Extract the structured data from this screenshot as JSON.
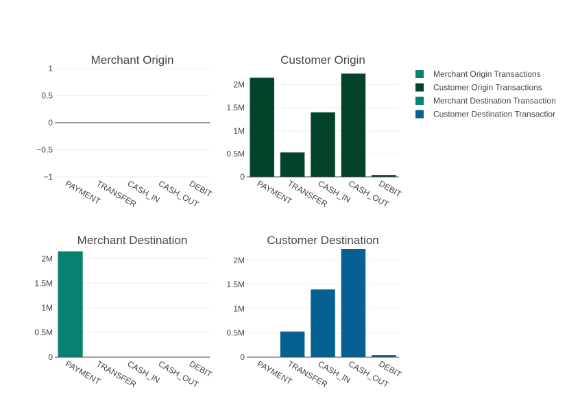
{
  "colors": {
    "merchant_origin": "#06826e",
    "customer_origin": "#03432a",
    "merchant_destination": "#06826e",
    "customer_destination": "#046191",
    "grid": "#eeeeee",
    "zeroline": "#444444",
    "text": "#444444"
  },
  "legend": {
    "items": [
      {
        "label": "Merchant Origin Transactions",
        "color": "#06826e"
      },
      {
        "label": "Customer Origin Transactions",
        "color": "#03432a"
      },
      {
        "label": "Merchant Destination Transaction",
        "color": "#06826e"
      },
      {
        "label": "Customer Destination Transactior",
        "color": "#046191"
      }
    ],
    "placement": "top-right"
  },
  "chart_data": [
    {
      "type": "bar",
      "title": "Merchant Origin",
      "categories": [
        "PAYMENT",
        "TRANSFER",
        "CASH_IN",
        "CASH_OUT",
        "DEBIT"
      ],
      "series": [
        {
          "name": "Merchant Origin Transactions",
          "values": [
            0,
            0,
            0,
            0,
            0
          ]
        }
      ],
      "ylim": [
        -1,
        1
      ],
      "yticks": [
        -1,
        -0.5,
        0,
        0.5,
        1
      ],
      "ytick_labels": [
        "−1",
        "−0.5",
        "0",
        "0.5",
        "1"
      ],
      "grid": true,
      "color": "#06826e"
    },
    {
      "type": "bar",
      "title": "Customer Origin",
      "categories": [
        "PAYMENT",
        "TRANSFER",
        "CASH_IN",
        "CASH_OUT",
        "DEBIT"
      ],
      "series": [
        {
          "name": "Customer Origin Transactions",
          "values": [
            2150000,
            530000,
            1400000,
            2240000,
            41000
          ]
        }
      ],
      "ylim": [
        0,
        2350000
      ],
      "yticks": [
        0,
        500000,
        1000000,
        1500000,
        2000000
      ],
      "ytick_labels": [
        "0",
        "0.5M",
        "1M",
        "1.5M",
        "2M"
      ],
      "grid": true,
      "color": "#03432a"
    },
    {
      "type": "bar",
      "title": "Merchant Destination",
      "categories": [
        "PAYMENT",
        "TRANSFER",
        "CASH_IN",
        "CASH_OUT",
        "DEBIT"
      ],
      "series": [
        {
          "name": "Merchant Destination Transaction",
          "values": [
            2150000,
            0,
            0,
            0,
            0
          ]
        }
      ],
      "ylim": [
        0,
        2200000
      ],
      "yticks": [
        0,
        500000,
        1000000,
        1500000,
        2000000
      ],
      "ytick_labels": [
        "0",
        "0.5M",
        "1M",
        "1.5M",
        "2M"
      ],
      "grid": true,
      "color": "#06826e"
    },
    {
      "type": "bar",
      "title": "Customer Destination",
      "categories": [
        "PAYMENT",
        "TRANSFER",
        "CASH_IN",
        "CASH_OUT",
        "DEBIT"
      ],
      "series": [
        {
          "name": "Customer Destination Transactior",
          "values": [
            0,
            530000,
            1400000,
            2240000,
            41000
          ]
        }
      ],
      "ylim": [
        0,
        2240000
      ],
      "yticks": [
        0,
        500000,
        1000000,
        1500000,
        2000000
      ],
      "ytick_labels": [
        "0",
        "0.5M",
        "1M",
        "1.5M",
        "2M"
      ],
      "grid": true,
      "color": "#046191"
    }
  ]
}
